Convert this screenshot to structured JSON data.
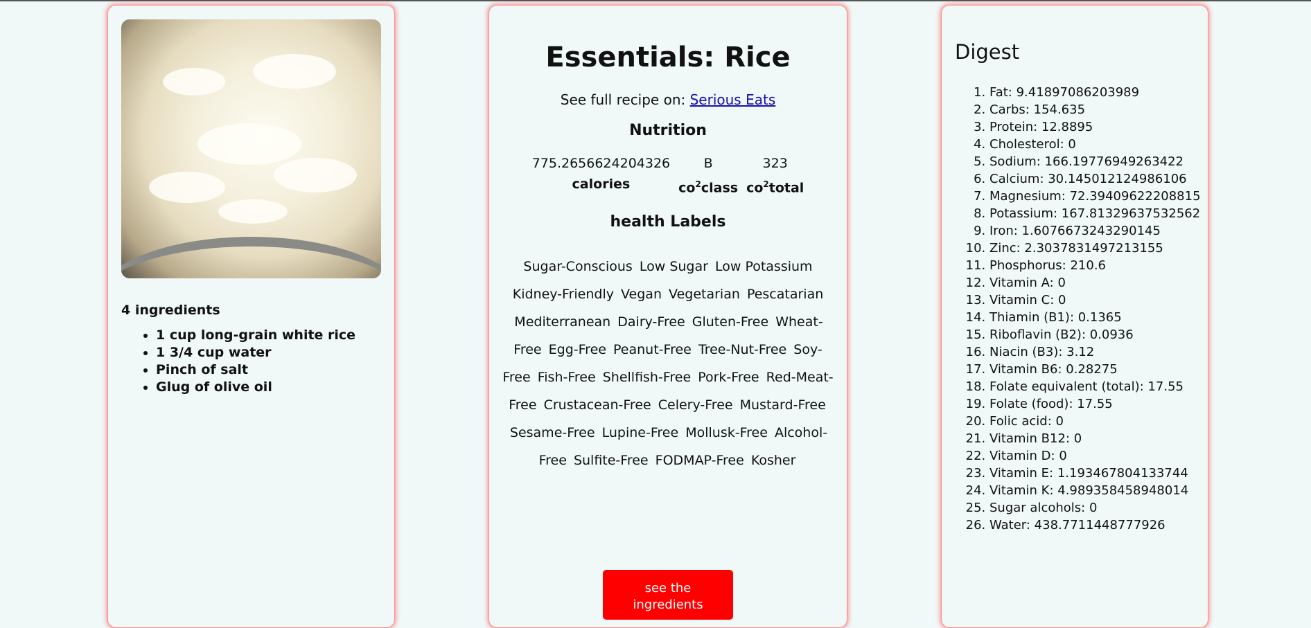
{
  "recipe": {
    "title": "Essentials: Rice",
    "source_prefix": "See full recipe on:",
    "source_name": "Serious Eats",
    "ingredients_count_text": "4 ingredients",
    "ingredients": [
      "1 cup long-grain white rice",
      "1 3/4 cup water",
      "Pinch of salt",
      "Glug of olive oil"
    ]
  },
  "nutrition": {
    "heading": "Nutrition",
    "calories_value": "775.2656624204326",
    "co2class_value": "B",
    "co2total_value": "323",
    "calories_label": "calories",
    "co2_prefix": "co",
    "co2_superscript": "2",
    "class_suffix": "class",
    "total_suffix": "total"
  },
  "health": {
    "heading": "health Labels",
    "labels": [
      "Sugar-Conscious",
      "Low Sugar",
      "Low Potassium",
      "Kidney-Friendly",
      "Vegan",
      "Vegetarian",
      "Pescatarian",
      "Mediterranean",
      "Dairy-Free",
      "Gluten-Free",
      "Wheat-Free",
      "Egg-Free",
      "Peanut-Free",
      "Tree-Nut-Free",
      "Soy-Free",
      "Fish-Free",
      "Shellfish-Free",
      "Pork-Free",
      "Red-Meat-Free",
      "Crustacean-Free",
      "Celery-Free",
      "Mustard-Free",
      "Sesame-Free",
      "Lupine-Free",
      "Mollusk-Free",
      "Alcohol-Free",
      "Sulfite-Free",
      "FODMAP-Free",
      "Kosher"
    ]
  },
  "button": {
    "label": "see the ingredients",
    "color": "#ff0000"
  },
  "digest": {
    "title": "Digest",
    "items": [
      "Fat: 9.41897086203989",
      "Carbs: 154.635",
      "Protein: 12.8895",
      "Cholesterol: 0",
      "Sodium: 166.19776949263422",
      "Calcium: 30.145012124986106",
      "Magnesium: 72.39409622208815",
      "Potassium: 167.81329637532562",
      "Iron: 1.6076673243290145",
      "Zinc: 2.3037831497213155",
      "Phosphorus: 210.6",
      "Vitamin A: 0",
      "Vitamin C: 0",
      "Thiamin (B1): 0.1365",
      "Riboflavin (B2): 0.0936",
      "Niacin (B3): 3.12",
      "Vitamin B6: 0.28275",
      "Folate equivalent (total): 17.55",
      "Folate (food): 17.55",
      "Folic acid: 0",
      "Vitamin B12: 0",
      "Vitamin D: 0",
      "Vitamin E: 1.193467804133744",
      "Vitamin K: 4.989358458948014",
      "Sugar alcohols: 0",
      "Water: 438.7711448777926"
    ]
  },
  "colors": {
    "background": "#f0f8f8",
    "card_glow": "#ff8a8a",
    "link": "#1a0dab"
  }
}
